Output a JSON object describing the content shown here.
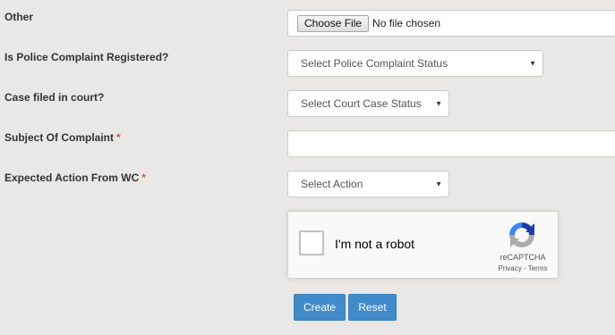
{
  "fields": {
    "other": {
      "label": "Other",
      "button_label": "Choose File",
      "status": "No file chosen"
    },
    "police_complaint": {
      "label": "Is Police Complaint Registered?",
      "selected": "Select Police Complaint Status"
    },
    "court_case": {
      "label": "Case filed in court?",
      "selected": "Select Court Case Status"
    },
    "subject": {
      "label": "Subject Of Complaint",
      "required_marker": "*",
      "value": ""
    },
    "expected_action": {
      "label": "Expected Action From WC",
      "required_marker": "*",
      "selected": "Select Action"
    }
  },
  "recaptcha": {
    "label": "I'm not a robot",
    "brand": "reCAPTCHA",
    "privacy": "Privacy",
    "separator": " - ",
    "terms": "Terms",
    "checked": false,
    "icon": "recaptcha-logo-icon"
  },
  "actions": {
    "create_label": "Create",
    "reset_label": "Reset"
  },
  "icons": {
    "select_arrow": "▼"
  },
  "colors": {
    "page_background": "#e9e8e6",
    "primary_button": "#428bca",
    "required_marker": "#d9534f",
    "recaptcha_blue": "#1c3aa9",
    "recaptcha_light_blue": "#4285f4",
    "recaptcha_gray": "#ababab"
  }
}
